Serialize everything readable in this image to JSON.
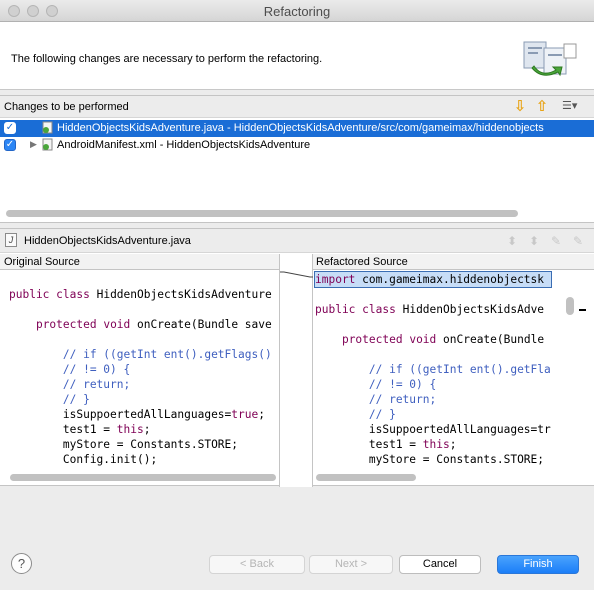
{
  "window": {
    "title": "Refactoring"
  },
  "header": {
    "message": "The following changes are necessary to perform the refactoring."
  },
  "changes": {
    "title": "Changes to be performed",
    "rows": [
      {
        "label": "HiddenObjectsKidsAdventure.java - HiddenObjectsKidsAdventure/src/com/gameimax/hiddenobjects",
        "checked": true,
        "selected": true
      },
      {
        "label": "AndroidManifest.xml - HiddenObjectsKidsAdventure",
        "checked": true,
        "selected": false
      }
    ]
  },
  "compare": {
    "file_title": "HiddenObjectsKidsAdventure.java",
    "original_header": "Original Source",
    "refactored_header": "Refactored Source",
    "original_lines": [
      "",
      "public class HiddenObjectsKidsAdventure",
      "",
      "    protected void onCreate(Bundle save",
      "",
      "        // if ((getInt ent().getFlags()",
      "        // != 0) {",
      "        // return;",
      "        // }",
      "        isSuppoertedAllLanguages=true;",
      "        test1 = this;",
      "        myStore = Constants.STORE;",
      "        Config.init();"
    ],
    "refactored_lines": [
      "import com.gameimax.hiddenobjectsk",
      "",
      "public class HiddenObjectsKidsAdve",
      "",
      "    protected void onCreate(Bundle",
      "",
      "        // if ((getInt ent().getFla",
      "        // != 0) {",
      "        // return;",
      "        // }",
      "        isSuppoertedAllLanguages=tr",
      "        test1 = this;",
      "        myStore = Constants.STORE;"
    ]
  },
  "buttons": {
    "help": "?",
    "back": "< Back",
    "next": "Next >",
    "cancel": "Cancel",
    "finish": "Finish"
  },
  "colors": {
    "selection": "#1a6dd6",
    "keyword": "#7f0055",
    "comment": "#3f5fbf",
    "primary_button": "#1b7ef8"
  }
}
